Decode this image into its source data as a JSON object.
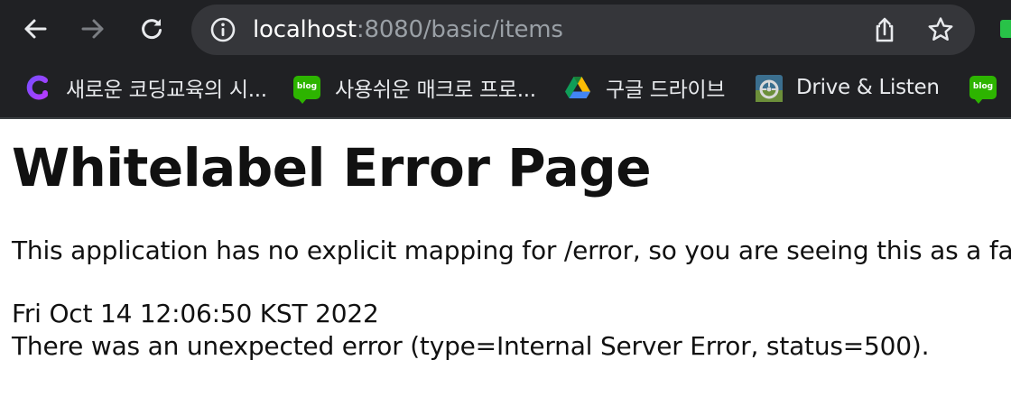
{
  "browser": {
    "url": {
      "host": "localhost",
      "rest": ":8080/basic/items"
    },
    "icons": {
      "back": "arrow-left-icon",
      "forward": "arrow-right-icon",
      "reload": "reload-icon",
      "site_info": "info-icon",
      "share": "share-icon",
      "bookmark_star": "star-icon"
    },
    "colors": {
      "chrome_bg": "#202124",
      "omnibox_bg": "#35363a",
      "url_host": "#ffffff",
      "url_rest": "#9aa0a6"
    }
  },
  "bookmarks": [
    {
      "label": "새로운 코딩교육의 시...",
      "icon": "purple-c-icon"
    },
    {
      "label": "사용쉬운 매크로 프로...",
      "icon": "blog-icon"
    },
    {
      "label": "구글 드라이브",
      "icon": "google-drive-icon"
    },
    {
      "label": "Drive & Listen",
      "icon": "drive-listen-icon"
    },
    {
      "label": "",
      "icon": "blog-icon",
      "badge": "blog"
    }
  ],
  "blog_badge_text": "blog",
  "page": {
    "title": "Whitelabel Error Page",
    "description": "This application has no explicit mapping for /error, so you are seeing this as a fallba",
    "timestamp": "Fri Oct 14 12:06:50 KST 2022",
    "error_message": "There was an unexpected error (type=Internal Server Error, status=500)."
  }
}
